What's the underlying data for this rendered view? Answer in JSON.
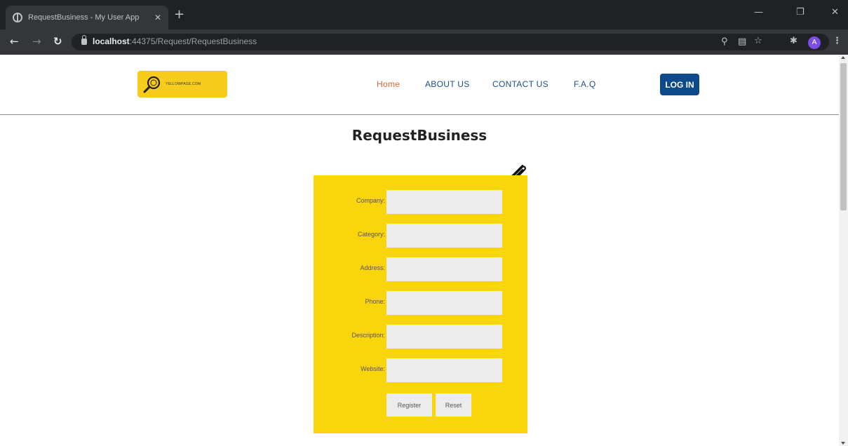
{
  "browser": {
    "tab_title": "RequestBusiness - My User App",
    "url_host": "localhost",
    "url_path": ":44375/Request/RequestBusiness",
    "profile_initial": "A"
  },
  "header": {
    "logo_text": "YELLOWPAGE.COM",
    "nav": [
      {
        "label": "Home",
        "active": true
      },
      {
        "label": "ABOUT US"
      },
      {
        "label": "CONTACT US"
      },
      {
        "label": "F.A.Q"
      }
    ],
    "login_label": "LOG IN"
  },
  "main": {
    "title": "RequestBusiness",
    "fields": [
      {
        "label": "Company:",
        "value": ""
      },
      {
        "label": "Category:",
        "value": ""
      },
      {
        "label": "Address:",
        "value": ""
      },
      {
        "label": "Phone:",
        "value": ""
      },
      {
        "label": "Description:",
        "value": ""
      },
      {
        "label": "Website:",
        "value": ""
      }
    ],
    "register_label": "Register",
    "reset_label": "Reset"
  },
  "colors": {
    "form_bg": "#f9d60c",
    "logo_bg": "#f7cc1d",
    "nav_link": "#1f4e8c",
    "nav_active": "#e8622a",
    "login_bg": "#0c4a8c"
  }
}
